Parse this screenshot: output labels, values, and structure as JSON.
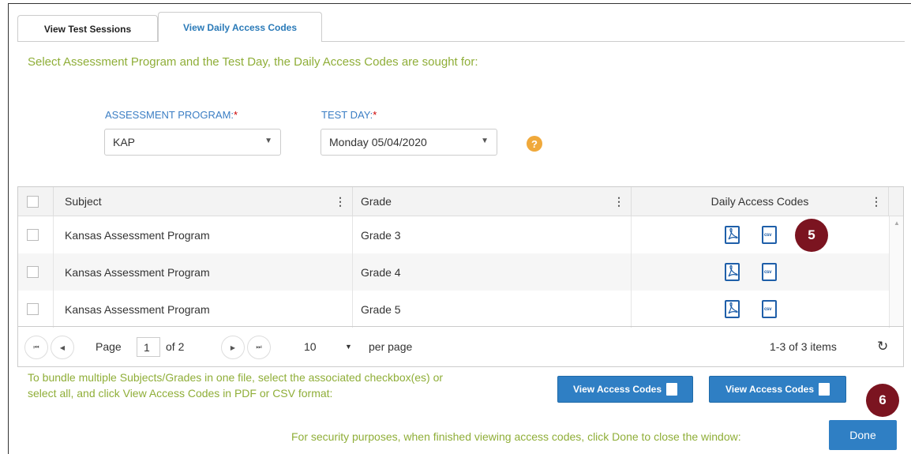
{
  "tabs": [
    {
      "label": "View Test Sessions"
    },
    {
      "label": "View Daily Access Codes"
    }
  ],
  "instruction": "Select Assessment Program and the Test Day, the Daily Access Codes are sought for:",
  "filters": {
    "program_label": "ASSESSMENT PROGRAM:",
    "program_value": "KAP",
    "day_label": "TEST DAY:",
    "day_value": "Monday 05/04/2020",
    "required_mark": "*",
    "help_glyph": "?"
  },
  "grid": {
    "columns": [
      "Subject",
      "Grade",
      "Daily Access Codes"
    ],
    "rows": [
      {
        "subject": "Kansas Assessment Program",
        "grade": "Grade 3"
      },
      {
        "subject": "Kansas Assessment Program",
        "grade": "Grade 4"
      },
      {
        "subject": "Kansas Assessment Program",
        "grade": "Grade 5"
      }
    ],
    "csv_text": "csv"
  },
  "pager": {
    "page_label": "Page",
    "page_value": "1",
    "of_text": "of 2",
    "page_size": "10",
    "per_page": "per page",
    "items_text": "1-3 of 3 items"
  },
  "footer": {
    "bundle_line1": "To bundle multiple Subjects/Grades in one file, select the associated checkbox(es) or",
    "bundle_line2": "select all, and click View Access Codes in PDF or CSV format:",
    "pdf_button": "View Access Codes",
    "csv_button": "View Access Codes",
    "security_text": "For security purposes, when finished viewing access codes, click Done to close the window:",
    "done_button": "Done"
  },
  "badges": {
    "step5": "5",
    "step6": "6"
  },
  "colors": {
    "accent": "#2f7fc4",
    "instruction": "#8fae38",
    "badge": "#7b1420",
    "help": "#f0a93b"
  }
}
